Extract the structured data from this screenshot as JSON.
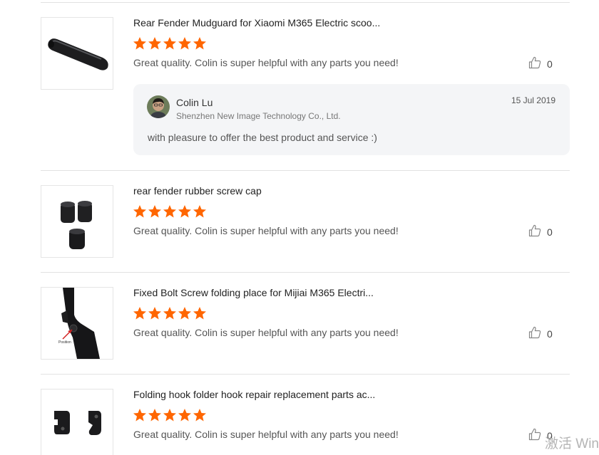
{
  "reviews": [
    {
      "product_title": "Rear Fender Mudguard for Xiaomi M365 Electric scoo...",
      "rating": 5,
      "text": "Great quality. Colin is super helpful with any parts you need!",
      "helpful_count": "0",
      "thumbnail": "rear-fender-mudguard-image",
      "reply": {
        "name": "Colin Lu",
        "company": "Shenzhen New Image Technology Co., Ltd.",
        "date": "15 Jul 2019",
        "text": "with pleasure to offer the best product and service :)"
      }
    },
    {
      "product_title": "rear fender rubber screw cap",
      "rating": 5,
      "text": "Great quality. Colin is super helpful with any parts you need!",
      "helpful_count": "0",
      "thumbnail": "rubber-screw-cap-image"
    },
    {
      "product_title": "Fixed Bolt Screw folding place for Mijiai M365 Electri...",
      "rating": 5,
      "text": "Great quality. Colin is super helpful with any parts you need!",
      "helpful_count": "0",
      "thumbnail": "folding-bolt-image",
      "thumbnail_caption": "Position"
    },
    {
      "product_title": "Folding hook folder hook repair replacement parts ac...",
      "rating": 5,
      "text": "Great quality. Colin is super helpful with any parts you need!",
      "helpful_count": "0",
      "thumbnail": "folding-hook-image"
    }
  ],
  "watermark": "激活 Win",
  "colors": {
    "star": "#ff6600",
    "divider": "#e2e2e2",
    "reply_background": "#f4f5f7"
  },
  "icons": {
    "star": "star-icon",
    "helpful": "thumbs-up-icon"
  }
}
